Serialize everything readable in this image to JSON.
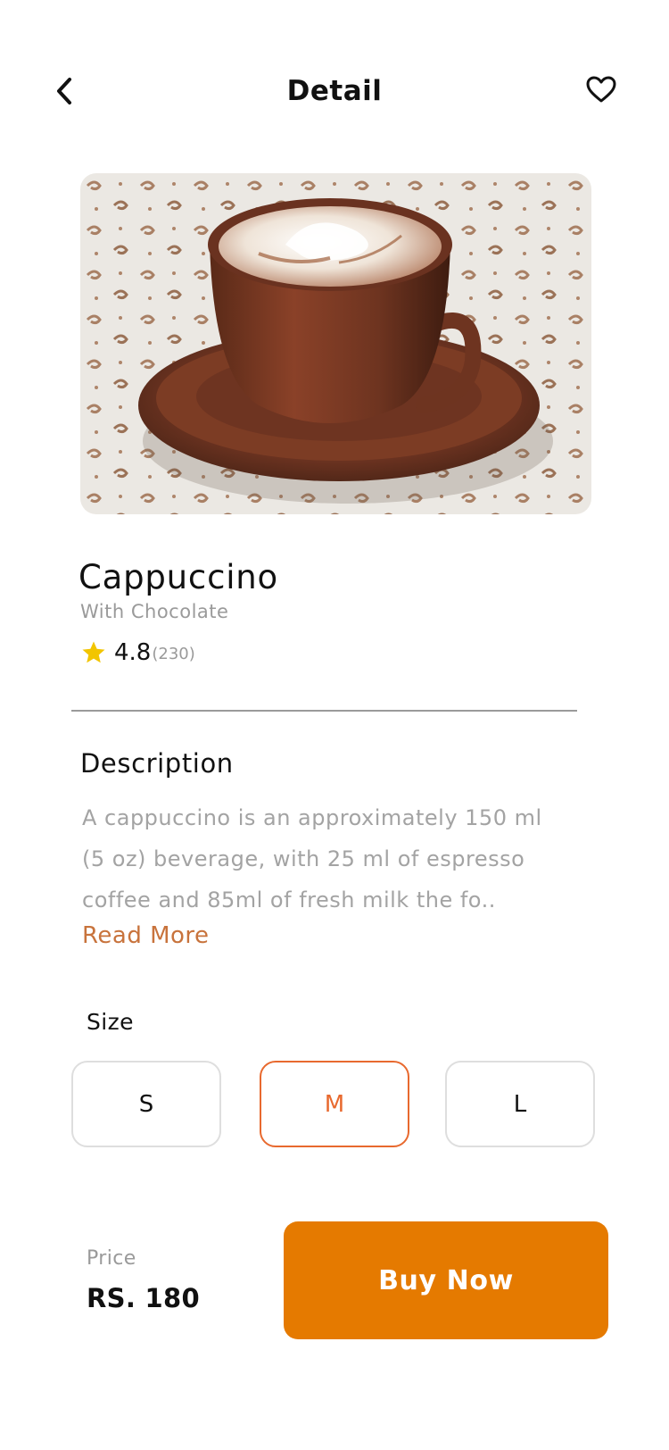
{
  "header": {
    "title": "Detail",
    "back_icon": "chevron-left-icon",
    "favorite_icon": "heart-outline-icon"
  },
  "product": {
    "image_subject": "cappuccino-cup-photo",
    "name": "Cappuccino",
    "subtitle": "With Chocolate",
    "rating": "4.8",
    "rating_count": "(230)",
    "rating_icon": "star-icon",
    "rating_color": "#f2c500"
  },
  "description": {
    "title": "Description",
    "text": "A cappuccino is an approximately 150 ml (5 oz) beverage, with 25 ml of espresso coffee and 85ml of fresh milk the fo..",
    "read_more": "Read More",
    "read_more_color": "#c8733c"
  },
  "size": {
    "label": "Size",
    "options": [
      "S",
      "M",
      "L"
    ],
    "selected": "M",
    "selected_color": "#e8692e"
  },
  "footer": {
    "price_label": "Price",
    "price_value": "RS. 180",
    "buy_button": "Buy Now",
    "buy_button_color": "#e57a00"
  }
}
